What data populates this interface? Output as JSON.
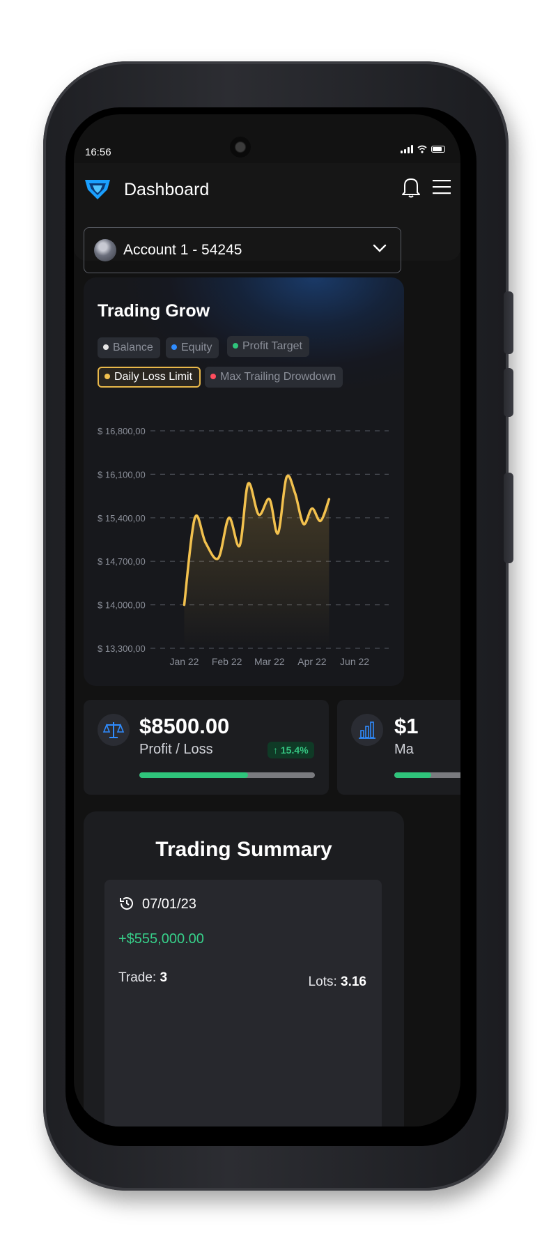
{
  "status_bar": {
    "time": "16:56"
  },
  "header": {
    "title": "Dashboard"
  },
  "account": {
    "label": "Account 1 - 54245"
  },
  "trading_grow": {
    "title": "Trading Grow",
    "legend": [
      {
        "label": "Balance",
        "color": "#e6e6e6",
        "active": false
      },
      {
        "label": "Equity",
        "color": "#2f8cff",
        "active": false
      },
      {
        "label": "Profit Target",
        "color": "#2fc47b",
        "active": false
      },
      {
        "label": "Daily Loss Limit",
        "color": "#f2c14e",
        "active": true
      },
      {
        "label": "Max Trailing Drowdown",
        "color": "#ff4d5e",
        "active": false
      }
    ]
  },
  "chart_data": {
    "type": "area",
    "y_tick_labels": [
      "$ 16,800,00",
      "$ 16,100,00",
      "$ 15,400,00",
      "$ 14,700,00",
      "$ 14,000,00",
      "$ 13,300,00"
    ],
    "y_ticks": [
      16800,
      16100,
      15400,
      14700,
      14000,
      13300
    ],
    "ylim": [
      13300,
      16800
    ],
    "categories": [
      "Jan 22",
      "Feb 22",
      "Mar 22",
      "Apr 22",
      "Jun 22"
    ],
    "x": [
      0.0,
      0.25,
      0.5,
      0.8,
      1.05,
      1.3,
      1.5,
      1.75,
      2.0,
      2.2,
      2.4,
      2.6,
      2.8,
      3.0,
      3.2,
      3.4,
      3.65,
      3.9,
      4.15,
      4.45
    ],
    "series": [
      {
        "color": "#f2c14e",
        "values": [
          14000,
          15400,
          15000,
          14750,
          15400,
          14950,
          15950,
          15450,
          15700,
          15150,
          16050,
          15800,
          15300,
          15550,
          15350,
          15700
        ]
      }
    ],
    "grid": true,
    "legend_position": "top"
  },
  "stats": [
    {
      "value": "$8500.00",
      "label": "Profit / Loss",
      "change": "15.4%",
      "progress": 0.62
    },
    {
      "value": "$1",
      "label": "Ma",
      "progress": 0.35
    }
  ],
  "summary": {
    "title": "Trading Summary",
    "date": "07/01/23",
    "amount": "+$555,000.00",
    "trade_label": "Trade:",
    "trade_value": "3",
    "lots_label": "Lots:",
    "lots_value": "3.16"
  }
}
